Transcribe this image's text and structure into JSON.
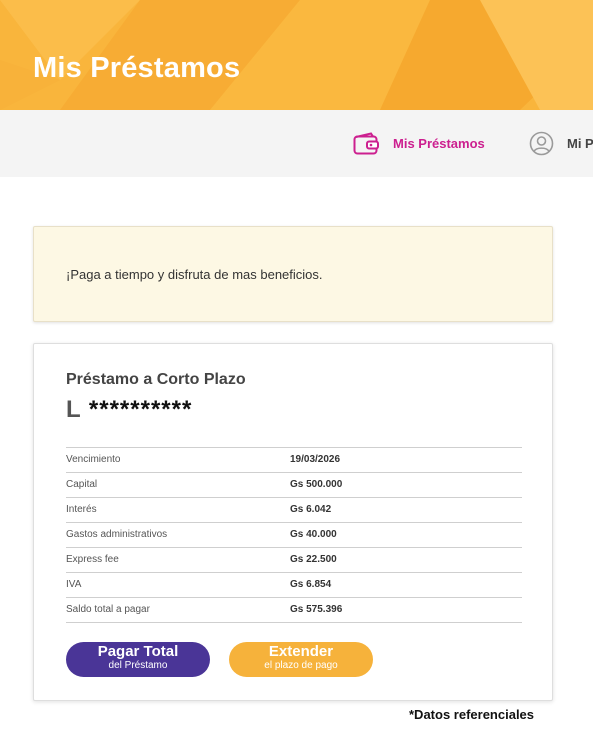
{
  "header": {
    "title": "Mis Préstamos"
  },
  "nav": {
    "items": [
      {
        "label": "Mis Préstamos",
        "icon": "wallet-icon",
        "active": true
      },
      {
        "label": "Mi Perfil",
        "icon": "user-circle-icon",
        "active": false
      }
    ]
  },
  "notice": {
    "text": "¡Paga a tiempo y disfruta de mas beneficios."
  },
  "loan": {
    "title": "Préstamo a Corto Plazo",
    "id_prefix": "L",
    "id_masked": "**********",
    "details": [
      {
        "label": "Vencimiento",
        "value": "19/03/2026"
      },
      {
        "label": "Capital",
        "value": "Gs 500.000"
      },
      {
        "label": "Interés",
        "value": "Gs 6.042"
      },
      {
        "label": "Gastos administrativos",
        "value": "Gs 40.000"
      },
      {
        "label": "Express fee",
        "value": "Gs 22.500"
      },
      {
        "label": "IVA",
        "value": "Gs 6.854"
      },
      {
        "label": "Saldo total a pagar",
        "value": "Gs 575.396"
      }
    ],
    "buttons": {
      "pay": {
        "label": "Pagar Total",
        "sub": "del Préstamo"
      },
      "extend": {
        "label": "Extender",
        "sub": "el plazo de pago"
      }
    }
  },
  "footnote": "*Datos referenciales",
  "colors": {
    "header_bg": "#f9b53c",
    "active_nav": "#cc1f8f",
    "pay_button": "#4a3597",
    "extend_button": "#f6b23b",
    "notice_bg": "#fdf8e4"
  }
}
